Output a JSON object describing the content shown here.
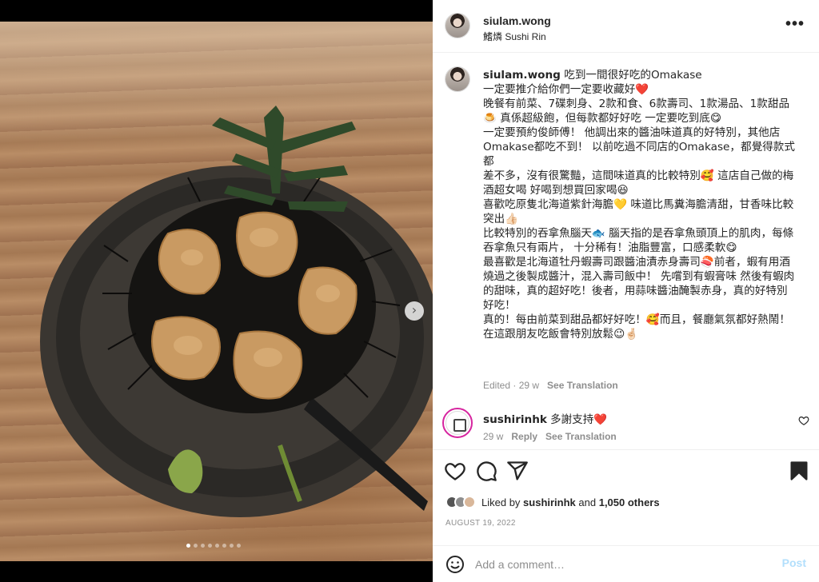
{
  "post": {
    "username": "siulam.wong",
    "location": "鰭燐 Sushi Rin",
    "more_icon": "more-options-icon",
    "carousel": {
      "total_images": 8,
      "current_index": 1
    }
  },
  "caption": {
    "username": "siulam.wong",
    "lines": [
      "吃到一間很好吃的Omakase",
      "一定要推介給你們一定要收藏好❤️",
      "",
      "晚餐有前菜、7碟刺身、2款和食、6款壽司、1款湯品、1款甜品",
      "🍮 真係超級飽，但每款都好好吃 一定要吃到底😋",
      "",
      "一定要預約俊師傅！ 他調出來的醬油味道真的好特別，其他店",
      "Omakase都吃不到！ 以前吃過不同店的Omakase，都覺得款式都",
      "差不多，沒有很驚豔，這間味道真的比較特別🥰 這店自己做的梅",
      "酒超女喝 好喝到想買回家喝😆",
      "",
      "喜歡吃原隻北海道紫針海膽💛 味道比馬糞海膽清甜，甘香味比較",
      "突出👍🏻",
      "比較特別的吞拿魚腦天🐟 腦天指的是吞拿魚頭頂上的肌肉，每條",
      "吞拿魚只有兩片， 十分稀有！油脂豐富，口感柔軟😋",
      "最喜歡是北海道牡丹蝦壽司跟醬油漬赤身壽司🍣前者，蝦有用酒",
      "燒過之後製成醬汁，混入壽司飯中！ 先嚐到有蝦膏味 然後有蝦肉",
      "的甜味，真的超好吃！後者，用蒜味醬油醃製赤身，真的好特別",
      "好吃！",
      "",
      "真的！每由前菜到甜品都好好吃！🥰而且，餐廳氣氛都好熱鬧！",
      "在這跟朋友吃飯會特別放鬆😉🤞🏻"
    ],
    "time": "Edited · 29 w",
    "see_translation": "See Translation"
  },
  "reply": {
    "username": "sushirinhk",
    "text": "多謝支持❤️",
    "time": "29 w",
    "reply_label": "Reply",
    "see_translation": "See Translation"
  },
  "actions": {
    "like_icon": "heart-icon",
    "comment_icon": "comment-icon",
    "share_icon": "share-icon",
    "save_icon": "bookmark-icon"
  },
  "likes": {
    "prefix": "Liked by ",
    "user": "sushirinhk",
    "middle": " and ",
    "others": "1,050 others"
  },
  "date": "AUGUST 19, 2022",
  "add_comment": {
    "emoji_icon": "emoji-icon",
    "placeholder": "Add a comment…",
    "post_label": "Post"
  }
}
